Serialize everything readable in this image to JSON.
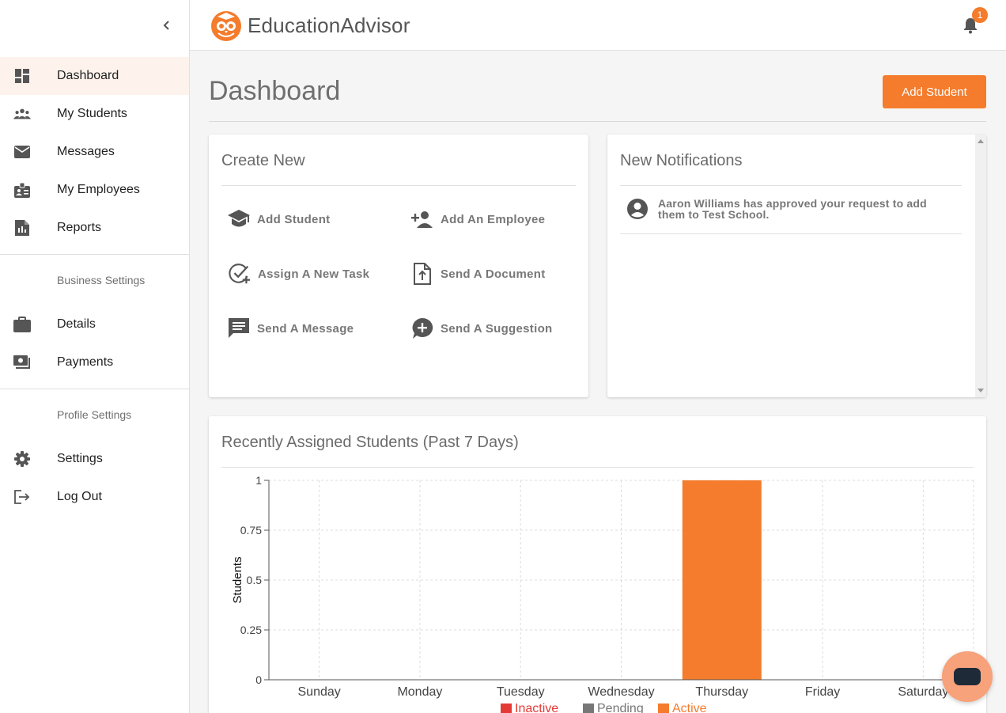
{
  "app": {
    "brand_part1": "Education",
    "brand_part2": "Advisor",
    "accent": "#f47c2c"
  },
  "header": {
    "notification_count": "1"
  },
  "sidebar": {
    "main_items": [
      {
        "label": "Dashboard",
        "icon": "dashboard-icon",
        "active": true
      },
      {
        "label": "My Students",
        "icon": "group-icon"
      },
      {
        "label": "Messages",
        "icon": "mail-icon"
      },
      {
        "label": "My Employees",
        "icon": "badge-icon"
      },
      {
        "label": "Reports",
        "icon": "report-icon"
      }
    ],
    "business_label": "Business Settings",
    "business_items": [
      {
        "label": "Details",
        "icon": "briefcase-icon"
      },
      {
        "label": "Payments",
        "icon": "payments-icon"
      }
    ],
    "profile_label": "Profile Settings",
    "profile_items": [
      {
        "label": "Settings",
        "icon": "gear-icon"
      },
      {
        "label": "Log Out",
        "icon": "logout-icon"
      }
    ]
  },
  "page": {
    "title": "Dashboard",
    "add_student_button": "Add Student"
  },
  "create_new": {
    "title": "Create New",
    "actions": [
      {
        "label": "Add Student",
        "icon": "school-cap-icon"
      },
      {
        "label": "Add An Employee",
        "icon": "person-add-icon"
      },
      {
        "label": "Assign A New Task",
        "icon": "task-add-icon"
      },
      {
        "label": "Send A Document",
        "icon": "document-upload-icon"
      },
      {
        "label": "Send A Message",
        "icon": "message-icon"
      },
      {
        "label": "Send A Suggestion",
        "icon": "suggestion-icon"
      }
    ]
  },
  "notifications": {
    "title": "New Notifications",
    "items": [
      {
        "text": "Aaron Williams has approved your request to add them to Test School.",
        "icon": "account-circle-icon"
      }
    ]
  },
  "chart_card": {
    "title": "Recently Assigned Students (Past 7 Days)"
  },
  "chart_data": {
    "type": "bar",
    "categories": [
      "Sunday",
      "Monday",
      "Tuesday",
      "Wednesday",
      "Thursday",
      "Friday",
      "Saturday"
    ],
    "series": [
      {
        "name": "Inactive",
        "color": "#e53935",
        "values": [
          0,
          0,
          0,
          0,
          0,
          0,
          0
        ]
      },
      {
        "name": "Pending",
        "color": "#777777",
        "values": [
          0,
          0,
          0,
          0,
          0,
          0,
          0
        ]
      },
      {
        "name": "Active",
        "color": "#f47c2c",
        "values": [
          0,
          0,
          0,
          0,
          1,
          0,
          0
        ]
      }
    ],
    "stacked": true,
    "ylabel": "Students",
    "ylim": [
      0,
      1
    ],
    "yticks": [
      "0",
      "0.25",
      "0.5",
      "0.75",
      "1"
    ],
    "grid": true,
    "legend": "bottom"
  }
}
